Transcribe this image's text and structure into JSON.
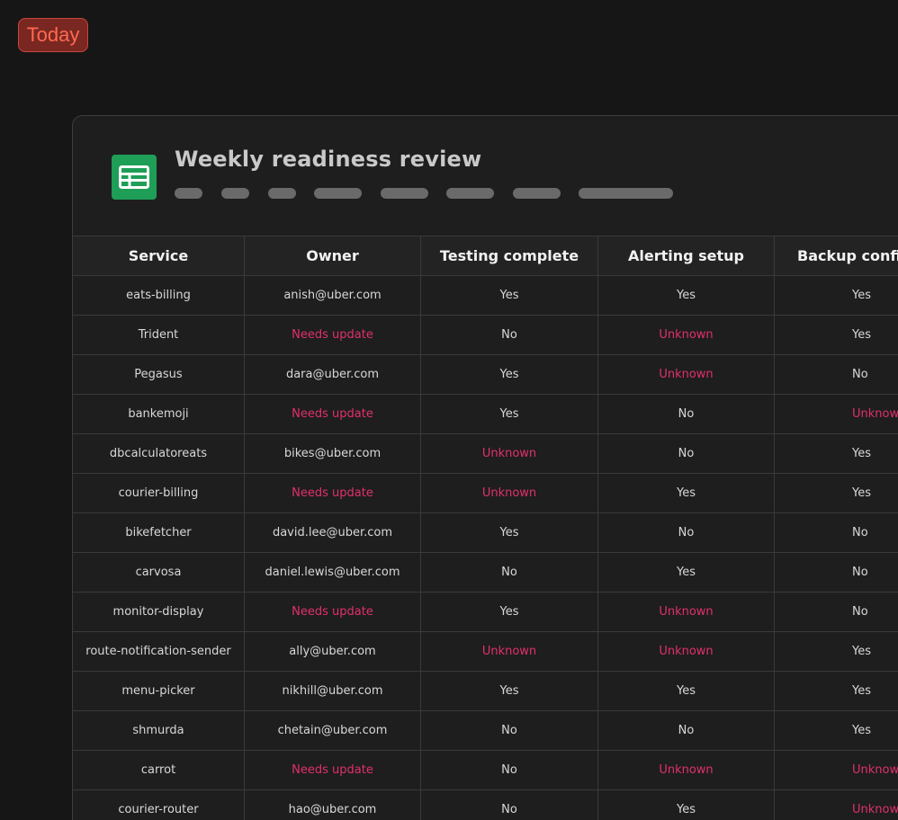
{
  "badge": {
    "label": "Today"
  },
  "document": {
    "title": "Weekly readiness review",
    "icon": "spreadsheet-icon",
    "icon_color": "#1e9e57"
  },
  "colors": {
    "background": "#161616",
    "card": "#1e1e1e",
    "badge_bg": "#7a2722",
    "badge_text": "#ff6a50",
    "warning_text": "#e1306c"
  },
  "table": {
    "columns": [
      "Service",
      "Owner",
      "Testing complete",
      "Alerting setup",
      "Backup configured"
    ],
    "rows": [
      [
        "eats-billing",
        "anish@uber.com",
        "Yes",
        "Yes",
        "Yes"
      ],
      [
        "Trident",
        "Needs update",
        "No",
        "Unknown",
        "Yes"
      ],
      [
        "Pegasus",
        "dara@uber.com",
        "Yes",
        "Unknown",
        "No"
      ],
      [
        "bankemoji",
        "Needs update",
        "Yes",
        "No",
        "Unknown"
      ],
      [
        "dbcalculatoreats",
        "bikes@uber.com",
        "Unknown",
        "No",
        "Yes"
      ],
      [
        "courier-billing",
        "Needs update",
        "Unknown",
        "Yes",
        "Yes"
      ],
      [
        "bikefetcher",
        "david.lee@uber.com",
        "Yes",
        "No",
        "No"
      ],
      [
        "carvosa",
        "daniel.lewis@uber.com",
        "No",
        "Yes",
        "No"
      ],
      [
        "monitor-display",
        "Needs update",
        "Yes",
        "Unknown",
        "No"
      ],
      [
        "route-notification-sender",
        "ally@uber.com",
        "Unknown",
        "Unknown",
        "Yes"
      ],
      [
        "menu-picker",
        "nikhill@uber.com",
        "Yes",
        "Yes",
        "Yes"
      ],
      [
        "shmurda",
        "chetain@uber.com",
        "No",
        "No",
        "Yes"
      ],
      [
        "carrot",
        "Needs update",
        "No",
        "Unknown",
        "Unknown"
      ],
      [
        "courier-router",
        "hao@uber.com",
        "No",
        "Yes",
        "Unknown"
      ]
    ]
  }
}
